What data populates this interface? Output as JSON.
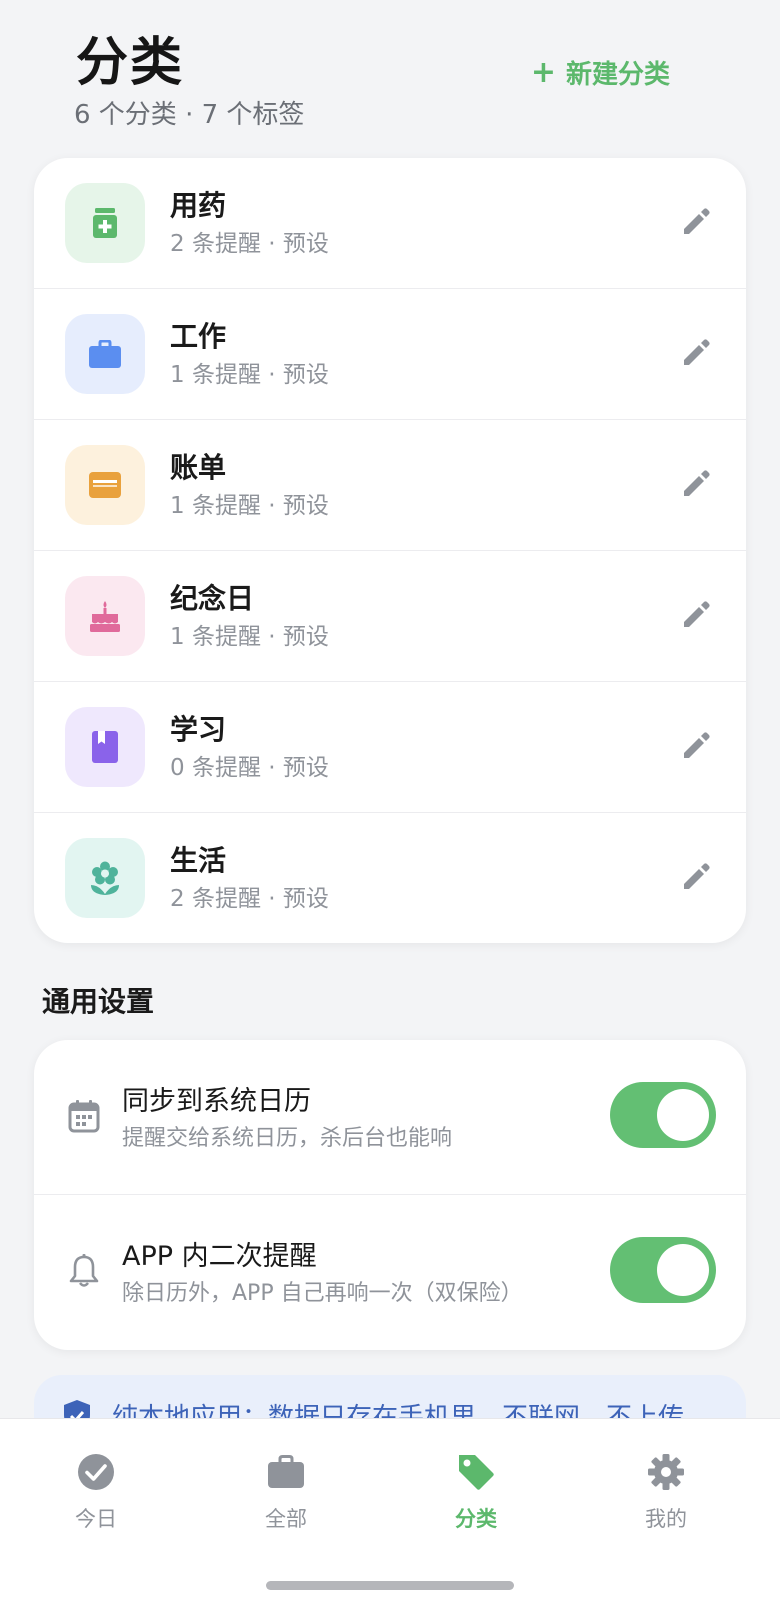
{
  "header": {
    "title": "分类",
    "subtitle": "6 个分类 · 7 个标签",
    "new_button": "新建分类"
  },
  "categories": [
    {
      "name": "用药",
      "meta": "2 条提醒 · 预设",
      "icon": "medicine-icon",
      "color": "#5cb86c",
      "bg": "#e6f5e9"
    },
    {
      "name": "工作",
      "meta": "1 条提醒 · 预设",
      "icon": "briefcase-icon",
      "color": "#5b8ef0",
      "bg": "#e6edfd"
    },
    {
      "name": "账单",
      "meta": "1 条提醒 · 预设",
      "icon": "wallet-icon",
      "color": "#e9a13c",
      "bg": "#fdf1dd"
    },
    {
      "name": "纪念日",
      "meta": "1 条提醒 · 预设",
      "icon": "cake-icon",
      "color": "#e06a9b",
      "bg": "#fbe8f0"
    },
    {
      "name": "学习",
      "meta": "0 条提醒 · 预设",
      "icon": "book-icon",
      "color": "#8a63ea",
      "bg": "#efe8fd"
    },
    {
      "name": "生活",
      "meta": "2 条提醒 · 预设",
      "icon": "flower-icon",
      "color": "#4fb39b",
      "bg": "#e2f5f1"
    }
  ],
  "settings": {
    "section_title": "通用设置",
    "items": [
      {
        "title": "同步到系统日历",
        "desc": "提醒交给系统日历，杀后台也能响",
        "icon": "calendar-icon",
        "enabled": true
      },
      {
        "title": "APP 内二次提醒",
        "desc": "除日历外，APP 自己再响一次（双保险）",
        "icon": "bell-icon",
        "enabled": true
      }
    ]
  },
  "notice": {
    "text": "纯本地应用：数据只存在手机里，不联网，不上传",
    "icon": "shield-icon"
  },
  "tabs": [
    {
      "label": "今日",
      "icon": "check-circle-icon",
      "active": false
    },
    {
      "label": "全部",
      "icon": "briefcase-icon",
      "active": false
    },
    {
      "label": "分类",
      "icon": "tag-icon",
      "active": true
    },
    {
      "label": "我的",
      "icon": "gear-icon",
      "active": false
    }
  ],
  "colors": {
    "accent": "#5cb86c",
    "inactive": "#8f939a",
    "toggle_on": "#63bf73",
    "notice": "#3d63b8"
  }
}
